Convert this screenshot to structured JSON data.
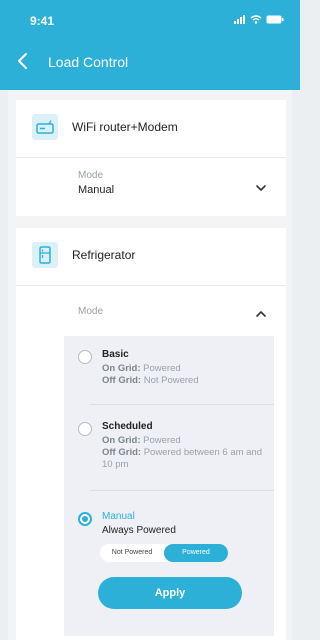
{
  "status_bar": {
    "time": "9:41",
    "icons": [
      "signal-icon",
      "wifi-icon",
      "battery-icon"
    ]
  },
  "header": {
    "title": "Load Control",
    "back_icon": "chevron-left-icon"
  },
  "colors": {
    "accent": "#2db0d8",
    "header_bg": "#2db0d8",
    "page_bg": "#eceff2",
    "panel_bg": "#eef0f5"
  },
  "devices": [
    {
      "name": "WiFi router+Modem",
      "icon": "router-icon",
      "mode_label": "Mode",
      "mode_value": "Manual",
      "expanded": false
    },
    {
      "name": "Refrigerator",
      "icon": "refrigerator-icon",
      "mode_label": "Mode",
      "expanded": true,
      "options": [
        {
          "title": "Basic",
          "on_grid_label": "On Grid:",
          "on_grid_value": "Powered",
          "off_grid_label": "Off Grid:",
          "off_grid_value": "Not Powered",
          "selected": false
        },
        {
          "title": "Scheduled",
          "on_grid_label": "On Grid:",
          "on_grid_value": "Powered",
          "off_grid_label": "Off Grid:",
          "off_grid_value": "Powered between 6 am and 10 pm",
          "selected": false
        },
        {
          "title": "Manual",
          "subtitle": "Always Powered",
          "selected": true
        }
      ],
      "toggle": {
        "off_label": "Not Powered",
        "on_label": "Powered",
        "selected": "Powered"
      },
      "apply_label": "Apply"
    }
  ]
}
